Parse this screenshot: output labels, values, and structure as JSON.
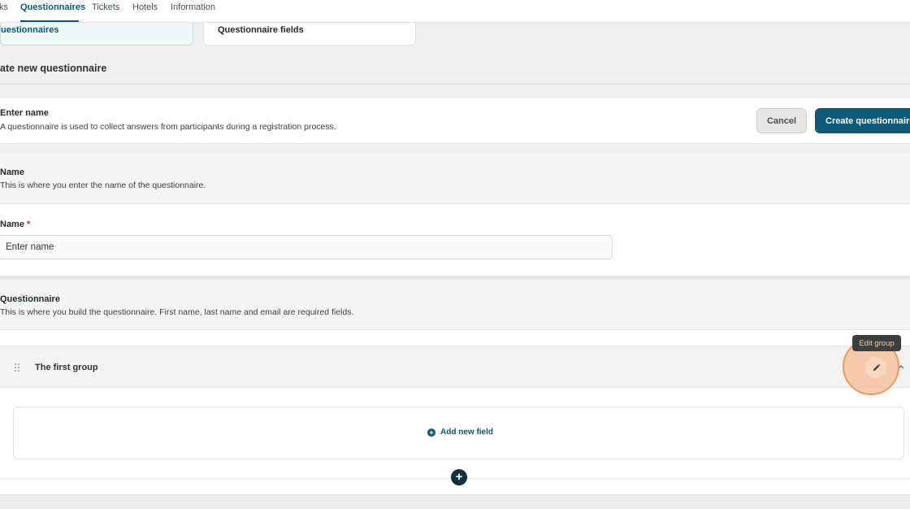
{
  "nav": {
    "tabs": [
      {
        "label": "ks"
      },
      {
        "label": "Questionnaires"
      },
      {
        "label": "Tickets"
      },
      {
        "label": "Hotels"
      },
      {
        "label": "Information"
      }
    ]
  },
  "subtabs": {
    "questionnaires": "uestionnaires",
    "fields": "Questionnaire fields"
  },
  "page": {
    "heading": "ate new questionnaire"
  },
  "card": {
    "title": "Enter name",
    "description": "A questionnaire is used to collect answers from participants during a registration process.",
    "cancel_label": "Cancel",
    "create_label": "Create questionnaire"
  },
  "name_section": {
    "title": "Name",
    "description": "This is where you enter the name of the questionnaire.",
    "field_label": "Name",
    "required_mark": "*",
    "placeholder": "Enter name"
  },
  "questionnaire_section": {
    "title": "Questionnaire",
    "description": "This is where you build the questionnaire. First name, last name and email are required fields."
  },
  "group": {
    "title": "The first group",
    "tooltip": "Edit group",
    "add_field_label": "Add new field"
  },
  "icons": {
    "drag": "drag-handle-icon",
    "edit": "pencil-icon",
    "collapse": "chevron-up-icon",
    "add": "plus-circle-icon"
  },
  "colors": {
    "brand": "#0c5a78",
    "highlight": "#ef9a5d",
    "required": "#c0262d"
  }
}
